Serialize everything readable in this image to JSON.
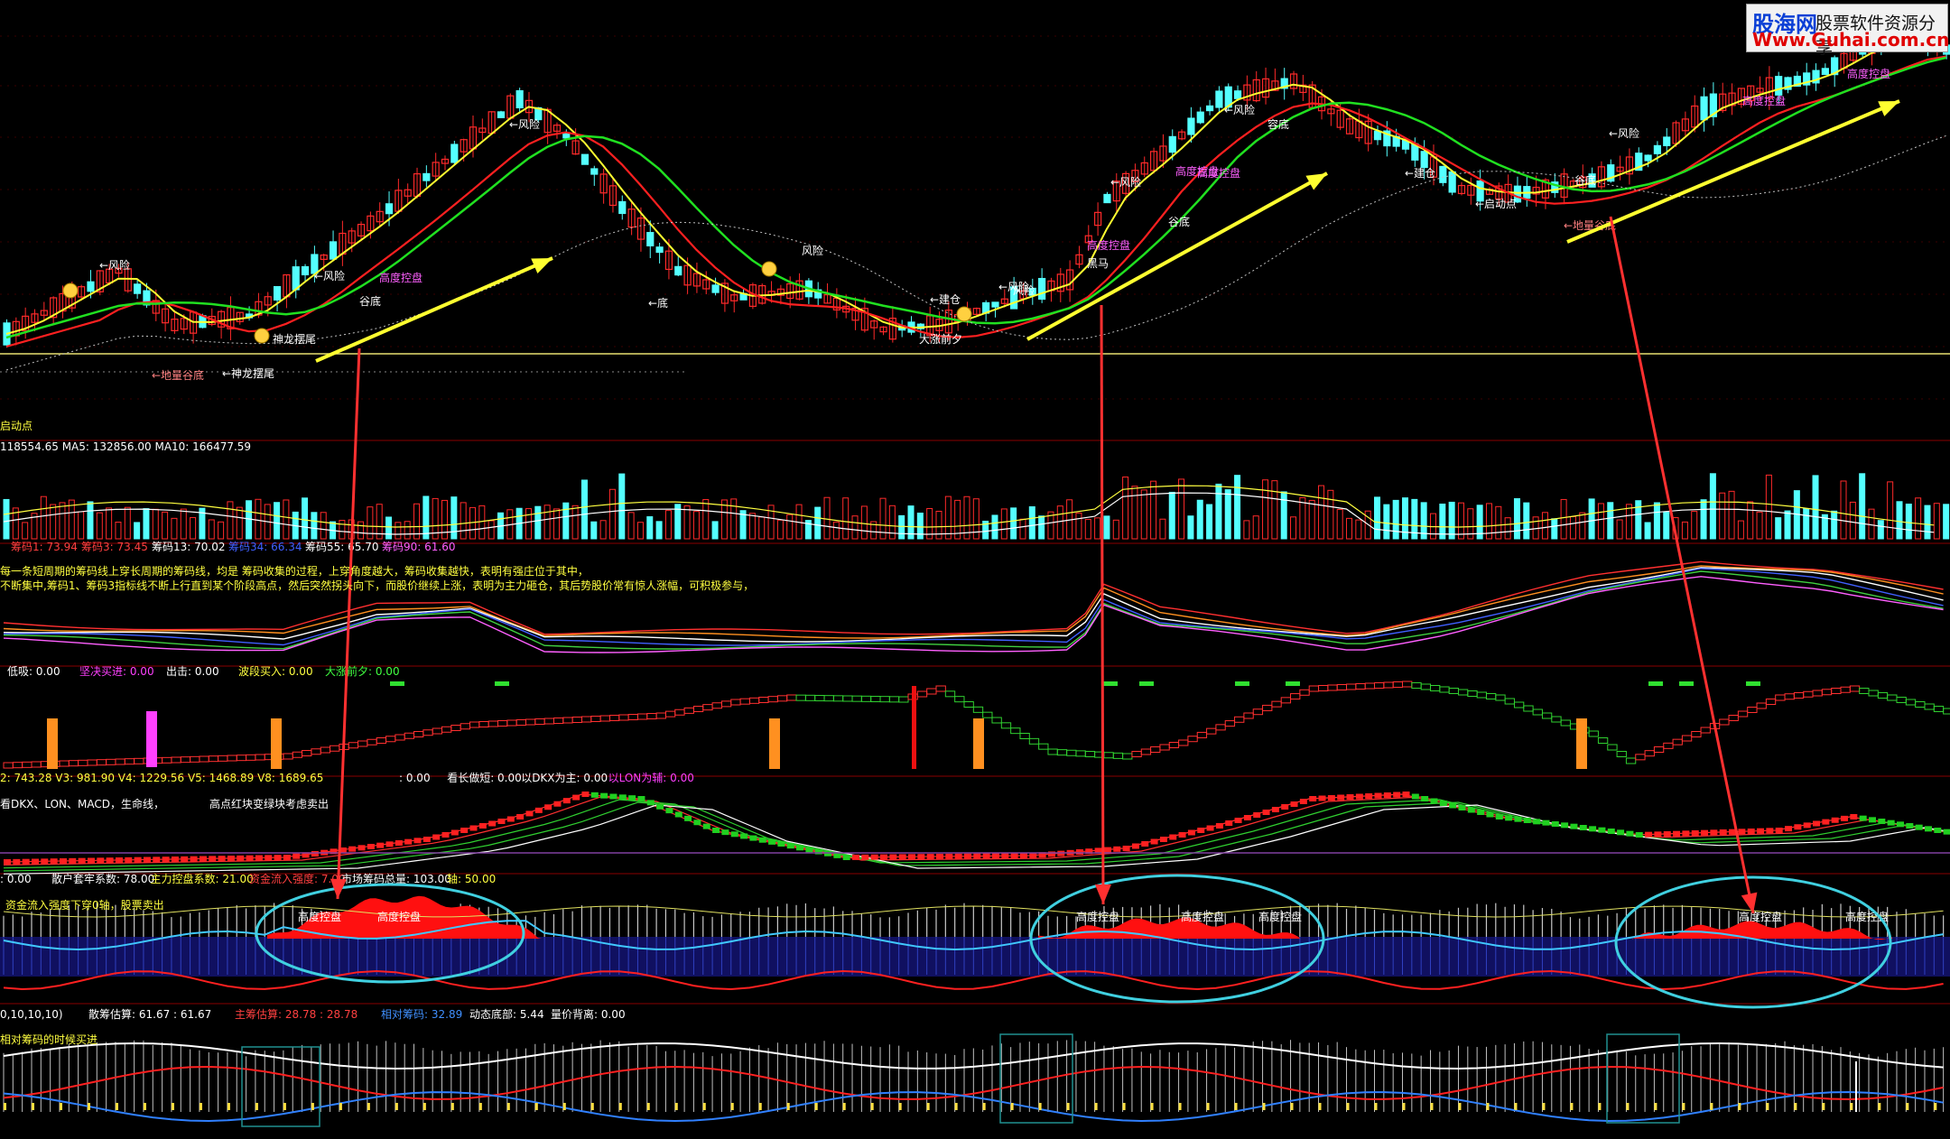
{
  "logo": {
    "brand": "股海网",
    "tagline": "股票软件资源分享",
    "url": "Www.Guhai.com.cn"
  },
  "colors": {
    "bg": "#000000",
    "up": "#ff2a2a",
    "down": "#54ffff",
    "ma_yellow": "#ffff30",
    "ma_red": "#ff2020",
    "ma_green": "#20e020",
    "arrow_yellow": "#ffff30",
    "arrow_red": "#ff3030",
    "ellipse": "#40d0e0",
    "grid": "#5a0000"
  },
  "main": {
    "labels": [
      "←风险",
      "高度控盘",
      "谷底",
      "←地量谷底",
      "神龙摆尾",
      "←神龙摆尾",
      "←风险",
      "←风险",
      "←底",
      "风险",
      "←建仓",
      "←风险",
      "大涨前夕",
      "风险",
      "高度控盘",
      "黑马",
      "←风险",
      "高度控盘",
      "谷底",
      "←风险",
      "容底",
      "高度控盘",
      "←建仓",
      "←启动点",
      "←地量谷底",
      "←风险",
      "谷底",
      "高度控盘",
      "高度控盘"
    ],
    "left_label": "启动点"
  },
  "volume": {
    "header": "118554.65  MA5: 132856.00  MA10: 166477.59"
  },
  "chip": {
    "header": [
      {
        "text": "筹码1: 73.94",
        "color": "#ff4040"
      },
      {
        "text": "筹码3: 73.45",
        "color": "#ff4040"
      },
      {
        "text": "筹码13: 70.02",
        "color": "#ffffff"
      },
      {
        "text": "筹码34: 66.34",
        "color": "#4060ff"
      },
      {
        "text": "筹码55: 65.70",
        "color": "#ffffff"
      },
      {
        "text": "筹码90: 61.60",
        "color": "#ff60ff"
      }
    ],
    "note1": "每一条短周期的筹码线上穿长周期的筹码线，均是 筹码收集的过程，上穿角度越大，筹码收集越快，表明有强庄位于其中，",
    "note2": "不断集中,筹码1、筹码3指标线不断上行直到某个阶段高点，然后突然拐头向下，而股价继续上涨，表明为主力砸仓，其后势股价常有惊人涨幅，可积极参与，"
  },
  "signal": {
    "header": [
      {
        "text": "低吸: 0.00",
        "color": "#ffffff"
      },
      {
        "text": "坚决买进: 0.00",
        "color": "#ff40ff"
      },
      {
        "text": "出击: 0.00",
        "color": "#ffffff"
      },
      {
        "text": "波段买入: 0.00",
        "color": "#ffff40"
      },
      {
        "text": "大涨前夕: 0.00",
        "color": "#40ff40"
      }
    ]
  },
  "dkx": {
    "header": [
      {
        "text": "2: 743.28  V3: 981.90  V4: 1229.56  V5: 1468.89  V8: 1689.65",
        "color": "#ffff40"
      },
      {
        "text": ": 0.00",
        "color": "#ffffff"
      },
      {
        "text": "看长做短: 0.00",
        "color": "#ffffff"
      },
      {
        "text": "以DKX为主: 0.00",
        "color": "#ffffff"
      },
      {
        "text": "以LON为辅: 0.00",
        "color": "#ff40ff"
      }
    ],
    "sub1": "看DKX、LON、MACD，生命线，",
    "sub2": "高点红块变绿块考虑卖出"
  },
  "control": {
    "header": [
      {
        "text": ": 0.00",
        "color": "#ffffff"
      },
      {
        "text": "散户套牢系数: 78.00",
        "color": "#ffffff"
      },
      {
        "text": "主力控盘系数: 21.00",
        "color": "#ffff40"
      },
      {
        "text": "资金流入强度: 7.00",
        "color": "#ff4040"
      },
      {
        "text": "市场筹码总量: 103.00",
        "color": "#ffffff"
      },
      {
        "text": "轴: 50.00",
        "color": "#ffff40"
      }
    ],
    "note": "资金流入强度下穿0轴，股票卖出",
    "labels": [
      "高度控盘",
      "高度控盘",
      "高度控盘",
      "高度控盘",
      "高度控盘",
      "高度控盘",
      "高度控盘"
    ]
  },
  "bottom": {
    "header": [
      {
        "text": "0,10,10,10)",
        "color": "#ffffff"
      },
      {
        "text": "散筹估算: 61.67 : 61.67",
        "color": "#ffffff"
      },
      {
        "text": "主筹估算: 28.78 : 28.78",
        "color": "#ff4040"
      },
      {
        "text": "相对筹码: 32.89",
        "color": "#4090ff"
      },
      {
        "text": "动态底部: 5.44",
        "color": "#ffffff"
      },
      {
        "text": "量价背离: 0.00",
        "color": "#ffffff"
      }
    ],
    "note": "相对筹码的时候买进"
  }
}
